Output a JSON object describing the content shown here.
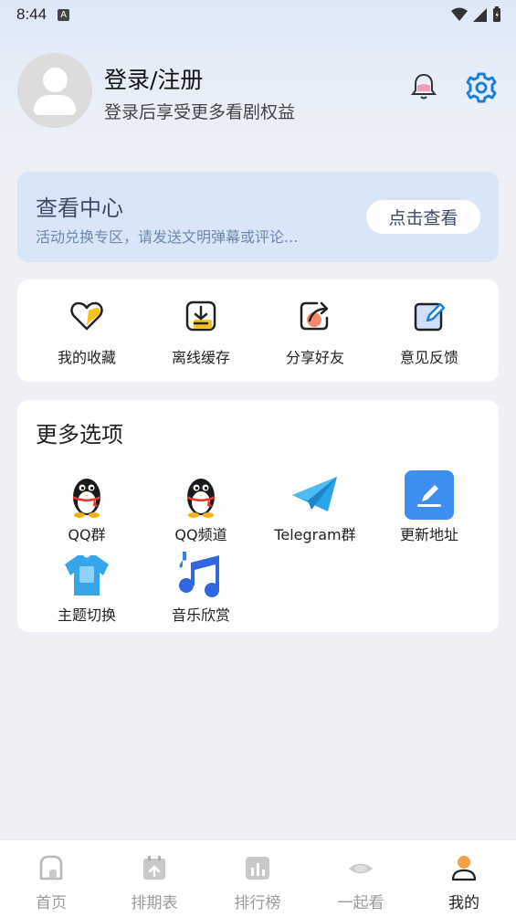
{
  "status_bar": {
    "time": "8:44",
    "notification_badge": "A"
  },
  "profile": {
    "title": "登录/注册",
    "subtitle": "登录后享受更多看剧权益"
  },
  "view_center": {
    "title": "查看中心",
    "subtitle": "活动兑换专区，请发送文明弹幕或评论...",
    "button_label": "点击查看"
  },
  "quick_actions": [
    {
      "label": "我的收藏",
      "icon": "heart-icon"
    },
    {
      "label": "离线缓存",
      "icon": "download-icon"
    },
    {
      "label": "分享好友",
      "icon": "share-icon"
    },
    {
      "label": "意见反馈",
      "icon": "feedback-edit-icon"
    }
  ],
  "more_options": {
    "title": "更多选项",
    "items": [
      {
        "label": "QQ群",
        "icon": "qq-penguin-icon"
      },
      {
        "label": "QQ频道",
        "icon": "qq-penguin-icon"
      },
      {
        "label": "Telegram群",
        "icon": "telegram-plane-icon"
      },
      {
        "label": "更新地址",
        "icon": "pen-edit-icon"
      },
      {
        "label": "主题切换",
        "icon": "tshirt-icon"
      },
      {
        "label": "音乐欣赏",
        "icon": "music-note-icon"
      }
    ]
  },
  "tab_bar": {
    "tabs": [
      {
        "label": "首页",
        "icon": "home-icon",
        "active": false
      },
      {
        "label": "排期表",
        "icon": "calendar-icon",
        "active": false
      },
      {
        "label": "排行榜",
        "icon": "ranking-chart-icon",
        "active": false
      },
      {
        "label": "一起看",
        "icon": "eye-icon",
        "active": false
      },
      {
        "label": "我的",
        "icon": "user-icon",
        "active": true
      }
    ]
  },
  "colors": {
    "accent": "#1e7fd8",
    "card_bg": "#d9e6f7",
    "icon_yellow": "#f6c21c",
    "icon_blue": "#4a8de8",
    "tab_active_orange": "#f4a04a"
  }
}
